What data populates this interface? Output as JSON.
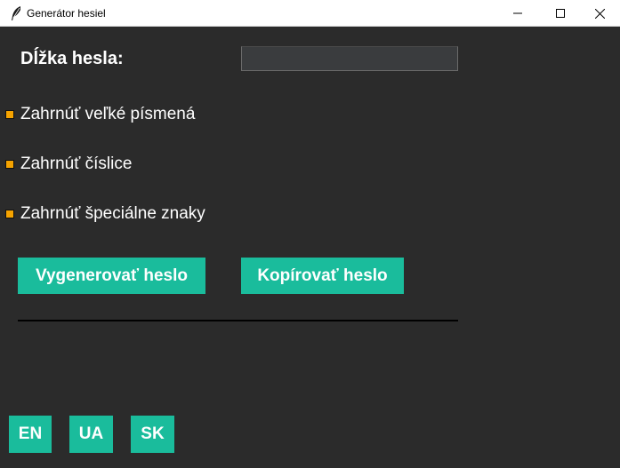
{
  "window": {
    "title": "Generátor hesiel"
  },
  "form": {
    "length_label": "Dĺžka hesla:",
    "length_value": "",
    "options": [
      {
        "label": "Zahrnúť veľké písmená",
        "checked": true
      },
      {
        "label": "Zahrnúť číslice",
        "checked": true
      },
      {
        "label": "Zahrnúť špeciálne znaky",
        "checked": true
      }
    ]
  },
  "actions": {
    "generate_label": "Vygenerovať heslo",
    "copy_label": "Kopírovať heslo"
  },
  "output": {
    "password": ""
  },
  "languages": [
    "EN",
    "UA",
    "SK"
  ],
  "colors": {
    "background": "#2b2b2b",
    "button": "#1abc9c",
    "checkbox": "#f5a300",
    "text": "#ffffff"
  },
  "icons": {
    "app": "feather-icon",
    "minimize": "minimize-icon",
    "maximize": "maximize-icon",
    "close": "close-icon"
  }
}
